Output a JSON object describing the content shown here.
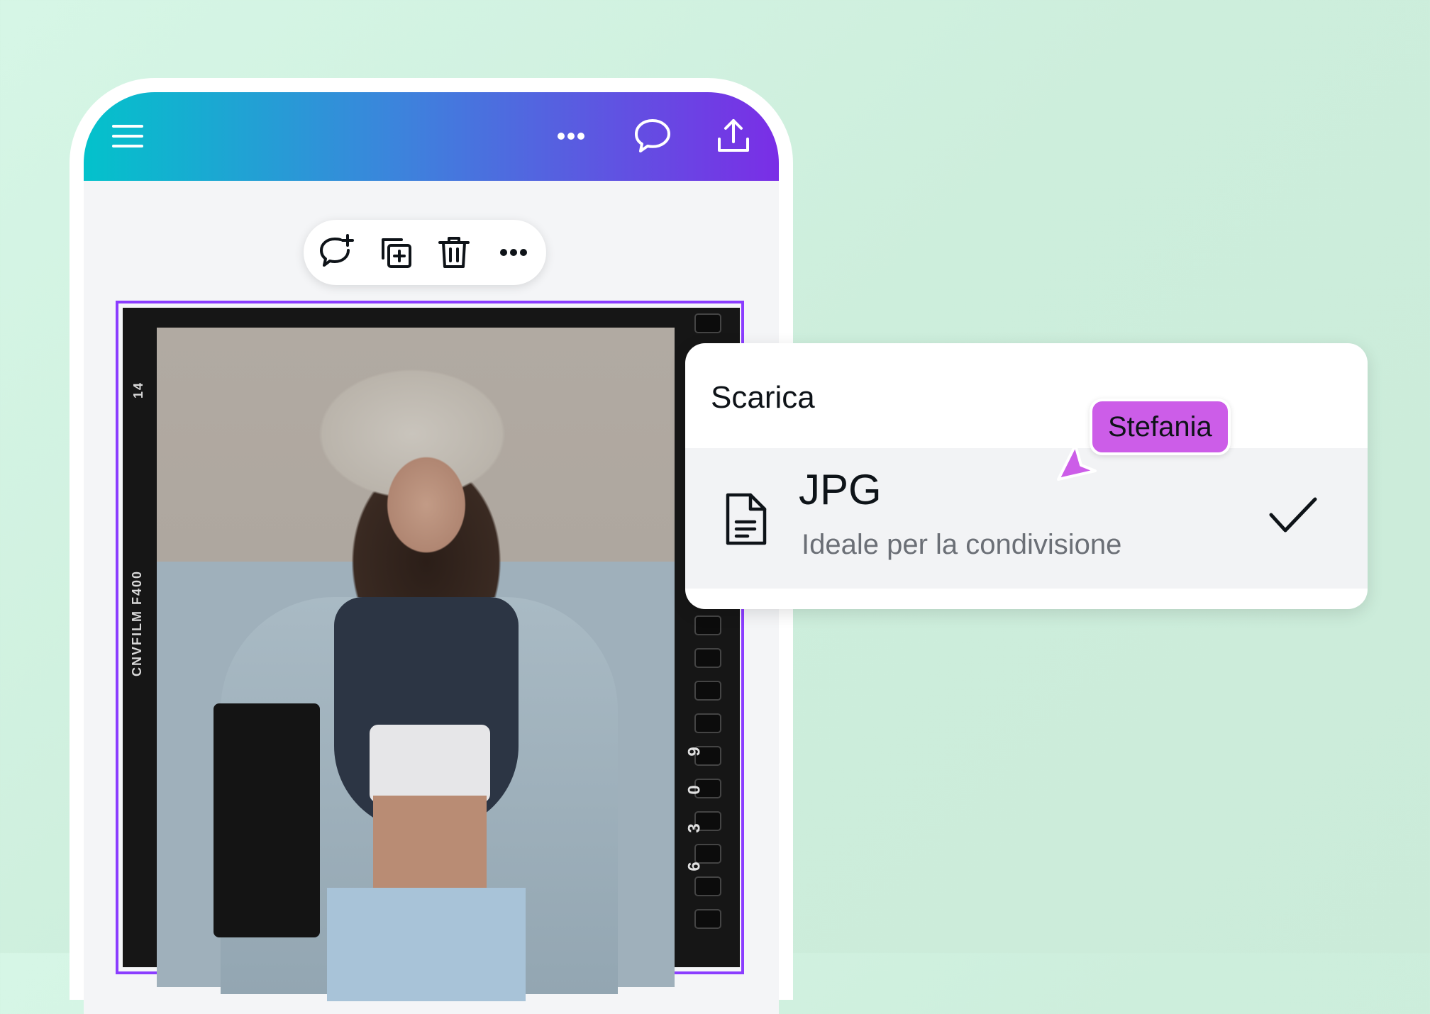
{
  "topbar": {
    "icons": [
      "menu-icon",
      "more-icon",
      "comment-icon",
      "share-icon"
    ]
  },
  "element_toolbar": {
    "icons": [
      "add-comment-icon",
      "duplicate-icon",
      "delete-icon",
      "more-icon"
    ]
  },
  "film_frame": {
    "edge_label": "CNVFILM F400",
    "frame_number": "14",
    "side_numbers": [
      "9",
      "0",
      "3",
      "6"
    ]
  },
  "download_panel": {
    "title": "Scarica",
    "option": {
      "format": "JPG",
      "description": "Ideale per la condivisione",
      "selected": true
    }
  },
  "collaborator": {
    "name": "Stefania",
    "color": "#cc5de8"
  },
  "colors": {
    "selection": "#8b3dff",
    "header_gradient_start": "#03c2cb",
    "header_gradient_end": "#7a2ee6"
  }
}
